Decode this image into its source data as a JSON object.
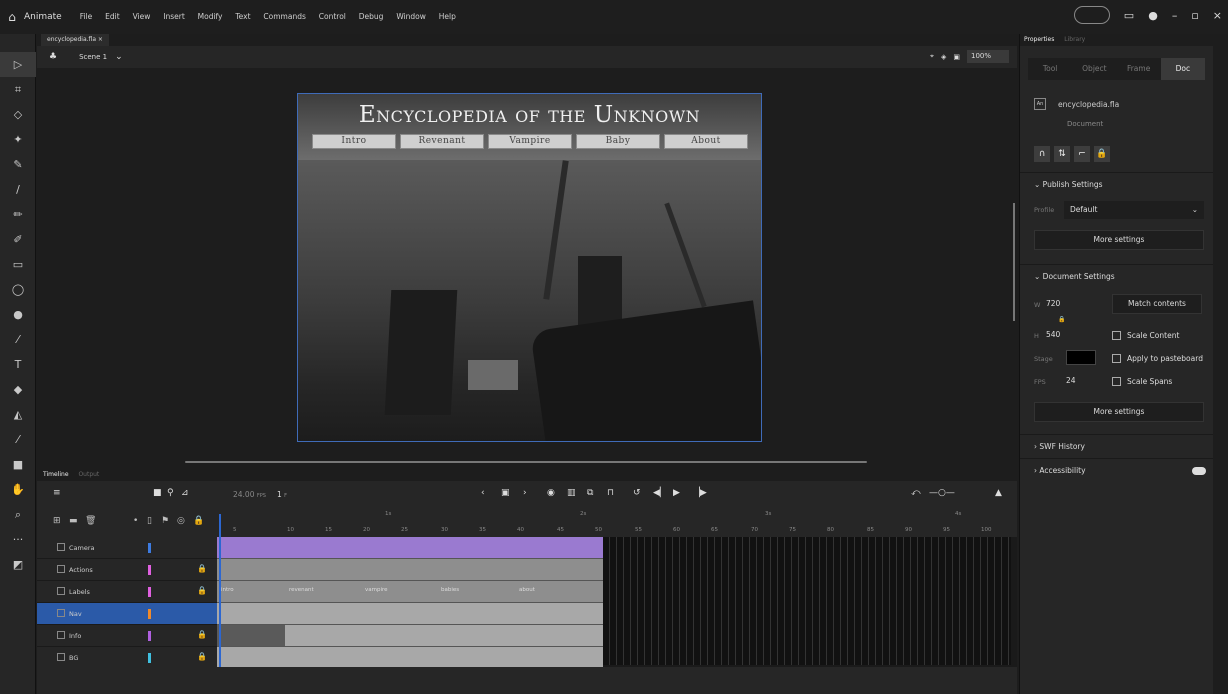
{
  "app": {
    "name": "Animate"
  },
  "menu": [
    "File",
    "Edit",
    "View",
    "Insert",
    "Modify",
    "Text",
    "Commands",
    "Control",
    "Debug",
    "Window",
    "Help"
  ],
  "document_tab": "encyclopedia.fla ×",
  "scene": "Scene 1",
  "zoom": "100%",
  "stage": {
    "title": "Encyclopedia of the Unknown",
    "nav": [
      "Intro",
      "Revenant",
      "Vampire",
      "Baby",
      "About"
    ]
  },
  "properties": {
    "panel_tabs": [
      "Properties",
      "Library"
    ],
    "tabs": [
      "Tool",
      "Object",
      "Frame",
      "Doc"
    ],
    "doc_name": "encyclopedia.fla",
    "doc_type": "Document",
    "publish": {
      "title": "Publish Settings",
      "profile_label": "Profile",
      "profile_value": "Default",
      "more": "More settings"
    },
    "document": {
      "title": "Document Settings",
      "w_label": "W",
      "w": "720",
      "h_label": "H",
      "h": "540",
      "stage_label": "Stage",
      "fps_label": "FPS",
      "fps": "24",
      "match": "Match contents",
      "scale_content": "Scale Content",
      "apply_paste": "Apply to pasteboard",
      "scale_spans": "Scale Spans",
      "more": "More settings"
    },
    "swf": "SWF History",
    "access": "Accessibility"
  },
  "timeline": {
    "tabs": [
      "Timeline",
      "Output"
    ],
    "fps": "24.00",
    "fps_unit": "FPS",
    "frame": "1",
    "frame_unit": "F",
    "ticks": [
      "5",
      "10",
      "15",
      "20",
      "25",
      "30",
      "35",
      "40",
      "45",
      "50",
      "55",
      "60",
      "65",
      "70",
      "75",
      "80",
      "85",
      "90",
      "95",
      "100"
    ],
    "seconds": [
      "1s",
      "2s",
      "3s",
      "4s"
    ],
    "layers": [
      {
        "name": "Camera",
        "color": "#3d7be0"
      },
      {
        "name": "Actions",
        "color": "#e060e0"
      },
      {
        "name": "Labels",
        "color": "#e060e0"
      },
      {
        "name": "Nav",
        "color": "#f08a2a"
      },
      {
        "name": "Info",
        "color": "#b060e0"
      },
      {
        "name": "BG",
        "color": "#40c0e0"
      }
    ],
    "labels": [
      "intro",
      "revenant",
      "vampire",
      "babies",
      "about"
    ]
  }
}
